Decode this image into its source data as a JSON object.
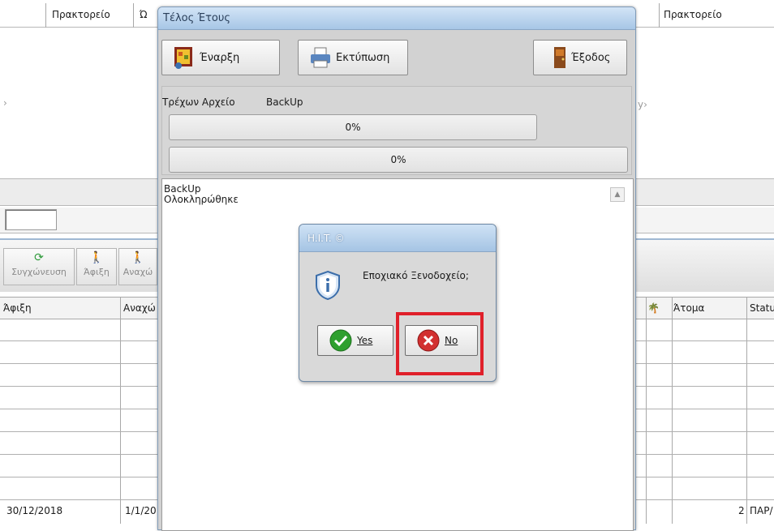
{
  "background": {
    "header_left": {
      "col_agency": "Πρακτορείο",
      "col_truncated": "Ώ"
    },
    "header_right": {
      "col_agency": "Πρακτορείο"
    },
    "left_arrow": "›",
    "right_fragment": "y›",
    "toolbar": [
      {
        "label": "Συγχώνευση",
        "icon": "sync-icon"
      },
      {
        "label": "Άφιξη",
        "icon": "arrival-icon"
      },
      {
        "label": "Αναχώ",
        "icon": "departure-icon"
      }
    ],
    "grid_left": {
      "col_arrival": "Άφιξη",
      "col_departure": "Αναχώ"
    },
    "grid_right": {
      "col_persons": "Άτομα",
      "col_status": "Statu"
    },
    "last_row": {
      "arrival": "30/12/2018",
      "departure": "1/1/20",
      "persons": "2",
      "status": "ΠΑΡ/"
    }
  },
  "dialog": {
    "title": "Τέλος Έτους",
    "buttons": {
      "start": {
        "label": "Έναρξη",
        "icon": "start-icon"
      },
      "print": {
        "label": "Εκτύπωση",
        "icon": "printer-icon"
      },
      "exit": {
        "label": "Έξοδος",
        "icon": "door-exit-icon"
      }
    },
    "current_file_label": "Τρέχων Αρχείο",
    "current_file_value": "BackUp",
    "progress_file": {
      "text": "0%",
      "value": 0
    },
    "progress_total": {
      "text": "0%",
      "value": 0
    },
    "log_lines": [
      "BackUp",
      "Ολοκληρώθηκε"
    ]
  },
  "message_box": {
    "title": "H.I.T. ©",
    "text": "Εποχιακό Ξενοδοχείο;",
    "icon": "info-shield-icon",
    "yes_label": "Yes",
    "no_label": "No",
    "highlighted": "no"
  },
  "colors": {
    "highlight": "#e0202a",
    "titlebar": "#a7c6e6",
    "yes_icon": "#2fa02f",
    "no_icon": "#d23030"
  }
}
